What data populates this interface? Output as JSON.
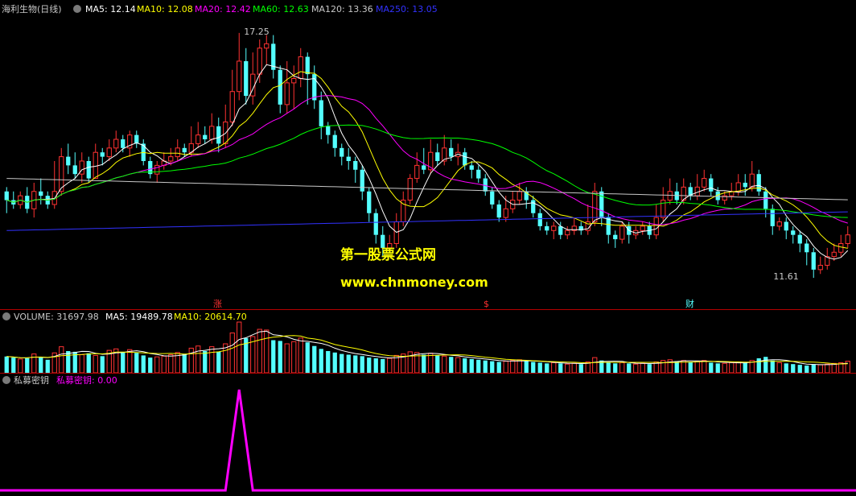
{
  "colors": {
    "background": "#000000",
    "up": "#ff3232",
    "down": "#54ffff",
    "ma5": "#ffffff",
    "ma10": "#ffff00",
    "ma20": "#ff00ff",
    "ma60": "#00ff00",
    "ma120": "#c8c8c8",
    "ma250": "#3232ff",
    "separator": "#b40000",
    "indicator": "#ff00ff",
    "watermark": "#ffff00"
  },
  "price_panel": {
    "title": "海利生物(日线)",
    "legend": [
      {
        "key": "ma5",
        "label": "MA5: 12.14"
      },
      {
        "key": "ma10",
        "label": "MA10: 12.08"
      },
      {
        "key": "ma20",
        "label": "MA20: 12.42"
      },
      {
        "key": "ma60",
        "label": "MA60: 12.63"
      },
      {
        "key": "ma120",
        "label": "MA120: 13.36"
      },
      {
        "key": "ma250",
        "label": "MA250: 13.05"
      }
    ],
    "high_label": "17.25",
    "low_label": "11.61",
    "markers": [
      "涨",
      "$",
      "财"
    ]
  },
  "volume_panel": {
    "title": "VOLUME: 31697.98",
    "ma5": "MA5: 19489.78",
    "ma10": "MA10: 20614.70"
  },
  "indicator_panel": {
    "title": "私募密钥",
    "value_label": "私募密钥: 0.00"
  },
  "watermark": {
    "line1": "第一股票公式网",
    "line2": "www.chnmoney.com"
  },
  "chart_data": {
    "type": "candlestick",
    "yrange": [
      11.0,
      17.6
    ],
    "high": 17.25,
    "low": 11.61,
    "candles": [
      [
        13.6,
        13.4,
        13.7,
        13.1
      ],
      [
        13.4,
        13.3,
        13.6,
        13.2
      ],
      [
        13.3,
        13.5,
        13.6,
        13.2
      ],
      [
        13.5,
        13.2,
        13.7,
        13.1
      ],
      [
        13.2,
        13.6,
        13.8,
        13.0
      ],
      [
        13.6,
        13.5,
        13.9,
        13.3
      ],
      [
        13.5,
        13.3,
        13.6,
        13.2
      ],
      [
        13.3,
        13.6,
        14.3,
        13.2
      ],
      [
        13.6,
        14.4,
        14.6,
        13.5
      ],
      [
        14.4,
        14.2,
        14.7,
        14.0
      ],
      [
        14.2,
        14.0,
        14.5,
        13.9
      ],
      [
        14.0,
        14.3,
        14.5,
        13.8
      ],
      [
        14.3,
        13.9,
        14.4,
        13.8
      ],
      [
        13.9,
        14.5,
        14.7,
        13.9
      ],
      [
        14.5,
        14.4,
        14.6,
        14.2
      ],
      [
        14.4,
        14.6,
        14.8,
        14.3
      ],
      [
        14.6,
        14.8,
        15.0,
        14.5
      ],
      [
        14.8,
        14.6,
        14.9,
        14.5
      ],
      [
        14.6,
        14.9,
        15.0,
        14.4
      ],
      [
        14.9,
        14.7,
        15.0,
        14.6
      ],
      [
        14.7,
        14.3,
        14.8,
        14.2
      ],
      [
        14.3,
        14.0,
        14.4,
        13.9
      ],
      [
        14.0,
        14.2,
        14.3,
        13.8
      ],
      [
        14.2,
        14.3,
        14.5,
        14.1
      ],
      [
        14.3,
        14.4,
        14.6,
        14.2
      ],
      [
        14.4,
        14.6,
        14.8,
        14.3
      ],
      [
        14.6,
        14.5,
        14.7,
        14.4
      ],
      [
        14.5,
        14.7,
        15.1,
        14.4
      ],
      [
        14.7,
        14.9,
        15.2,
        14.6
      ],
      [
        14.9,
        14.8,
        15.1,
        14.7
      ],
      [
        14.8,
        15.1,
        15.4,
        14.7
      ],
      [
        15.1,
        14.7,
        15.3,
        14.5
      ],
      [
        14.7,
        15.2,
        15.6,
        14.6
      ],
      [
        15.2,
        15.9,
        16.4,
        15.1
      ],
      [
        15.9,
        16.6,
        17.25,
        15.7
      ],
      [
        16.6,
        15.8,
        16.9,
        15.6
      ],
      [
        15.8,
        16.3,
        16.8,
        15.6
      ],
      [
        16.3,
        16.9,
        17.1,
        16.1
      ],
      [
        16.9,
        17.0,
        17.2,
        16.5
      ],
      [
        17.0,
        16.4,
        17.2,
        16.2
      ],
      [
        16.4,
        15.6,
        16.5,
        15.4
      ],
      [
        15.6,
        16.1,
        16.6,
        15.4
      ],
      [
        16.1,
        16.2,
        16.5,
        15.5
      ],
      [
        16.2,
        16.7,
        16.9,
        16.0
      ],
      [
        16.7,
        16.3,
        16.8,
        15.6
      ],
      [
        16.3,
        15.7,
        16.5,
        15.5
      ],
      [
        15.7,
        15.1,
        15.9,
        14.8
      ],
      [
        15.1,
        14.9,
        15.2,
        14.7
      ],
      [
        14.9,
        14.6,
        15.0,
        14.4
      ],
      [
        14.6,
        14.4,
        14.7,
        14.2
      ],
      [
        14.4,
        14.3,
        14.6,
        14.1
      ],
      [
        14.3,
        14.1,
        14.4,
        13.8
      ],
      [
        14.1,
        13.6,
        14.2,
        13.4
      ],
      [
        13.6,
        13.1,
        13.7,
        12.9
      ],
      [
        13.1,
        12.6,
        13.2,
        12.4
      ],
      [
        12.6,
        12.3,
        12.8,
        12.1
      ],
      [
        12.3,
        12.4,
        12.6,
        12.2
      ],
      [
        12.4,
        12.9,
        13.1,
        12.3
      ],
      [
        12.9,
        13.4,
        13.6,
        12.8
      ],
      [
        13.4,
        13.9,
        14.0,
        13.3
      ],
      [
        13.9,
        14.2,
        14.5,
        13.8
      ],
      [
        14.2,
        14.1,
        14.6,
        14.0
      ],
      [
        14.1,
        14.5,
        14.8,
        14.0
      ],
      [
        14.5,
        14.3,
        14.7,
        14.2
      ],
      [
        14.3,
        14.6,
        14.9,
        14.2
      ],
      [
        14.6,
        14.4,
        14.8,
        14.3
      ],
      [
        14.4,
        14.5,
        14.7,
        14.2
      ],
      [
        14.5,
        14.2,
        14.6,
        14.1
      ],
      [
        14.2,
        14.1,
        14.3,
        13.9
      ],
      [
        14.1,
        13.9,
        14.2,
        13.8
      ],
      [
        13.9,
        13.6,
        14.0,
        13.5
      ],
      [
        13.6,
        13.3,
        13.7,
        13.2
      ],
      [
        13.3,
        13.0,
        13.4,
        12.9
      ],
      [
        13.0,
        13.2,
        13.5,
        12.9
      ],
      [
        13.2,
        13.4,
        13.6,
        13.1
      ],
      [
        13.4,
        13.6,
        13.8,
        13.3
      ],
      [
        13.6,
        13.4,
        13.7,
        13.2
      ],
      [
        13.4,
        13.1,
        13.5,
        13.0
      ],
      [
        13.1,
        12.8,
        13.2,
        12.7
      ],
      [
        12.8,
        12.7,
        12.9,
        12.6
      ],
      [
        12.7,
        12.8,
        12.9,
        12.5
      ],
      [
        12.8,
        12.6,
        12.9,
        12.5
      ],
      [
        12.6,
        12.7,
        12.8,
        12.5
      ],
      [
        12.7,
        12.8,
        13.0,
        12.6
      ],
      [
        12.8,
        12.7,
        12.9,
        12.6
      ],
      [
        12.7,
        12.9,
        13.3,
        12.6
      ],
      [
        12.9,
        13.6,
        13.8,
        12.8
      ],
      [
        13.6,
        13.0,
        13.7,
        12.8
      ],
      [
        13.0,
        12.6,
        13.1,
        12.4
      ],
      [
        12.6,
        12.5,
        12.7,
        12.3
      ],
      [
        12.5,
        12.8,
        12.9,
        12.4
      ],
      [
        12.8,
        12.6,
        12.9,
        12.4
      ],
      [
        12.6,
        12.7,
        12.8,
        12.5
      ],
      [
        12.7,
        12.8,
        12.9,
        12.6
      ],
      [
        12.8,
        12.6,
        12.9,
        12.5
      ],
      [
        12.6,
        13.0,
        13.3,
        12.5
      ],
      [
        13.0,
        13.4,
        13.7,
        12.9
      ],
      [
        13.4,
        13.6,
        13.9,
        13.3
      ],
      [
        13.6,
        13.4,
        13.8,
        13.3
      ],
      [
        13.4,
        13.7,
        13.9,
        13.3
      ],
      [
        13.7,
        13.5,
        13.8,
        13.4
      ],
      [
        13.5,
        13.7,
        14.0,
        13.4
      ],
      [
        13.7,
        13.9,
        14.1,
        13.6
      ],
      [
        13.9,
        13.6,
        14.0,
        13.5
      ],
      [
        13.6,
        13.4,
        13.7,
        13.3
      ],
      [
        13.4,
        13.5,
        13.6,
        13.3
      ],
      [
        13.5,
        13.6,
        13.8,
        13.4
      ],
      [
        13.6,
        13.8,
        14.0,
        13.5
      ],
      [
        13.8,
        13.7,
        14.0,
        13.5
      ],
      [
        13.7,
        14.0,
        14.3,
        13.6
      ],
      [
        14.0,
        13.6,
        14.1,
        13.5
      ],
      [
        13.6,
        13.2,
        13.7,
        13.0
      ],
      [
        13.2,
        12.8,
        13.3,
        12.6
      ],
      [
        12.8,
        12.9,
        13.0,
        12.7
      ],
      [
        12.9,
        12.7,
        13.0,
        12.5
      ],
      [
        12.7,
        12.6,
        12.8,
        12.4
      ],
      [
        12.6,
        12.4,
        12.7,
        12.2
      ],
      [
        12.4,
        12.2,
        12.5,
        11.9
      ],
      [
        12.2,
        11.8,
        12.3,
        11.61
      ],
      [
        11.8,
        11.9,
        12.1,
        11.7
      ],
      [
        11.9,
        12.1,
        12.3,
        11.8
      ],
      [
        12.1,
        12.2,
        12.4,
        12.0
      ],
      [
        12.2,
        12.4,
        12.6,
        12.1
      ],
      [
        12.4,
        12.6,
        12.8,
        12.3
      ]
    ],
    "volume": [
      45,
      42,
      38,
      40,
      52,
      44,
      36,
      55,
      72,
      60,
      58,
      50,
      54,
      48,
      46,
      62,
      66,
      58,
      64,
      55,
      48,
      42,
      44,
      46,
      50,
      56,
      52,
      68,
      74,
      60,
      72,
      58,
      80,
      110,
      140,
      96,
      100,
      120,
      118,
      90,
      88,
      80,
      86,
      96,
      84,
      74,
      66,
      60,
      56,
      52,
      50,
      48,
      46,
      42,
      40,
      38,
      40,
      48,
      52,
      58,
      56,
      50,
      54,
      48,
      46,
      44,
      42,
      40,
      38,
      36,
      34,
      32,
      30,
      32,
      34,
      36,
      32,
      30,
      28,
      26,
      28,
      26,
      24,
      26,
      24,
      30,
      42,
      34,
      28,
      26,
      28,
      26,
      24,
      26,
      24,
      30,
      34,
      36,
      32,
      34,
      30,
      32,
      34,
      28,
      26,
      26,
      28,
      30,
      28,
      34,
      40,
      44,
      34,
      28,
      26,
      24,
      22,
      20,
      24,
      22,
      24,
      26,
      28,
      32
    ],
    "indicator_peak": {
      "index": 34,
      "value": 1
    }
  }
}
